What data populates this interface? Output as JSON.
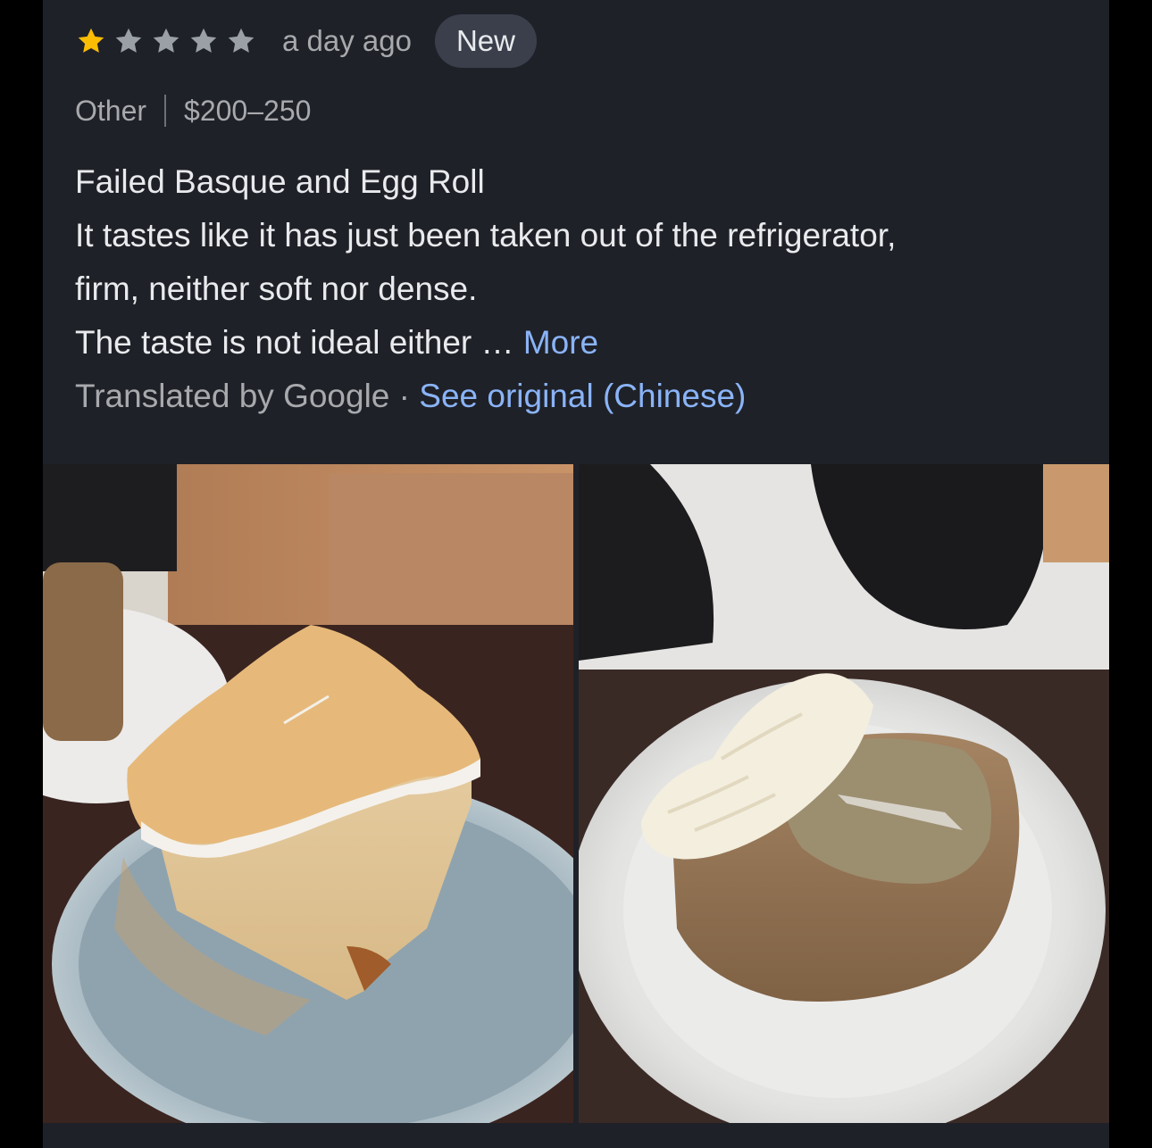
{
  "review": {
    "rating": 1,
    "max_rating": 5,
    "time": "a day ago",
    "badge": "New",
    "category": "Other",
    "price": "$200–250",
    "lines": [
      "Failed Basque and Egg Roll",
      "It tastes like it has just been taken out of the refrigerator,",
      "firm, neither soft nor dense.",
      "The taste is not ideal either …"
    ],
    "more_label": "More",
    "translated_by": "Translated by Google",
    "separator_dot": "·",
    "see_original_label": "See original (Chinese)"
  },
  "photos": [
    {
      "icon": "cheesecake-photo"
    },
    {
      "icon": "egg-roll-cake-photo"
    }
  ],
  "colors": {
    "background": "#000000",
    "card": "#1f2128",
    "star_filled": "#fbbc04",
    "star_empty": "#9aa0a6",
    "link": "#8ab4f8",
    "text_primary": "#e8eaed",
    "text_secondary": "#a7a9ad",
    "badge_bg": "#3a3f4b"
  }
}
